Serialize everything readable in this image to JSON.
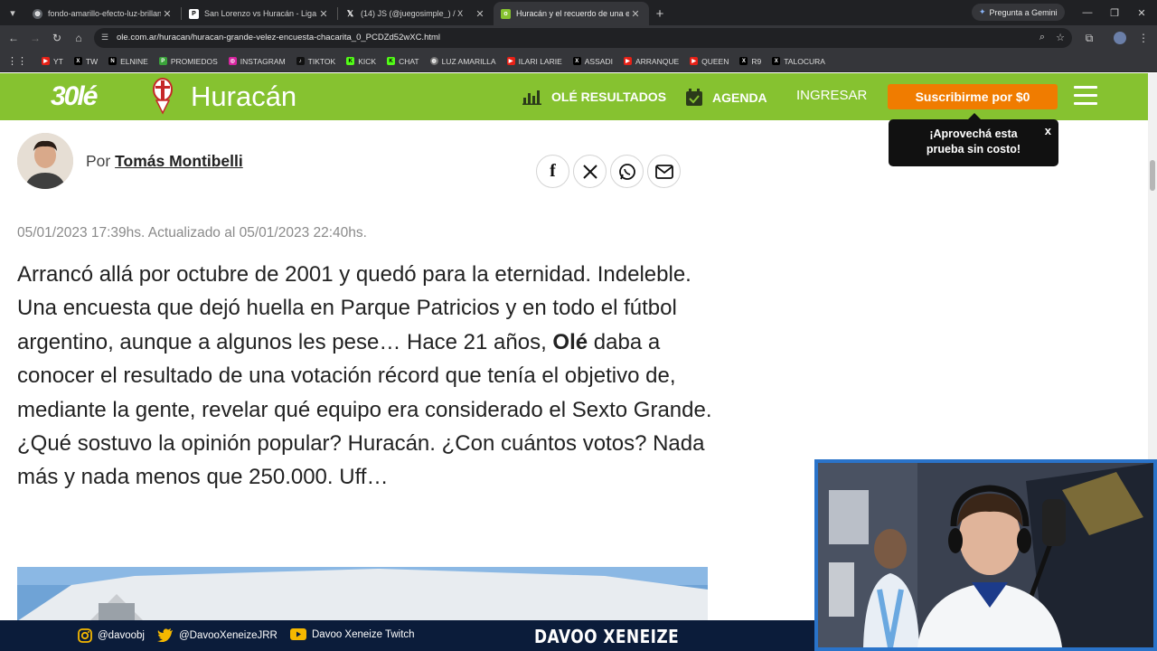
{
  "browser": {
    "tabs": [
      {
        "title": "fondo-amarillo-efecto-luz-brillante"
      },
      {
        "title": "San Lorenzo vs Huracán - Liga Profesional"
      },
      {
        "title": "(14) JS (@juegosimple_) / X"
      },
      {
        "title": "Huracán y el recuerdo de una encuesta"
      }
    ],
    "gemini_label": "Pregunta a Gemini",
    "url": "ole.com.ar/huracan/huracan-grande-velez-encuesta-chacarita_0_PCDZd52wXC.html",
    "bookmarks": [
      "YT",
      "TW",
      "ELNINE",
      "PROMIEDOS",
      "INSTAGRAM",
      "TIKTOK",
      "KICK",
      "CHAT",
      "LUZ AMARILLA",
      "ILARI LARIE",
      "ASSADI",
      "ARRANQUE",
      "QUEEN",
      "R9",
      "TALOCURA"
    ]
  },
  "header": {
    "logo_text": "30lé",
    "club_name": "Huracán",
    "nav_results": "OLÉ RESULTADOS",
    "nav_agenda": "AGENDA",
    "nav_login": "INGRESAR",
    "subscribe": "Suscribirme por $0"
  },
  "promo": {
    "line1": "¡Aprovechá esta",
    "line2": "prueba sin costo!",
    "close": "x"
  },
  "article": {
    "by_prefix": "Por",
    "author": "Tomás Montibelli",
    "dateline": "05/01/2023 17:39hs. Actualizado al 05/01/2023 22:40hs.",
    "body_before_bold": "Arrancó allá por octubre de 2001 y quedó para la eternidad. Indeleble. Una encuesta que dejó huella en Parque Patricios y en todo el fútbol argentino, aunque a algunos les pese… Hace 21 años, ",
    "body_bold": "Olé",
    "body_after_bold": " daba a conocer el resultado de una votación récord que tenía el objetivo de, mediante la gente, revelar qué equipo era considerado el Sexto Grande. ¿Qué sostuvo la opinión popular? Huracán. ¿Con cuántos votos? Nada más y nada menos que 250.000. Uff…"
  },
  "stream": {
    "instagram": "@davoobj",
    "twitter": "@DavooXeneizeJRR",
    "youtube": "Davoo Xeneize Twitch",
    "title": "DAVOO XENEIZE"
  },
  "colors": {
    "ole_green": "#86c230",
    "subscribe_orange": "#f07c00",
    "stream_bar": "#0b1c3a",
    "webcam_border": "#2a73c9"
  }
}
